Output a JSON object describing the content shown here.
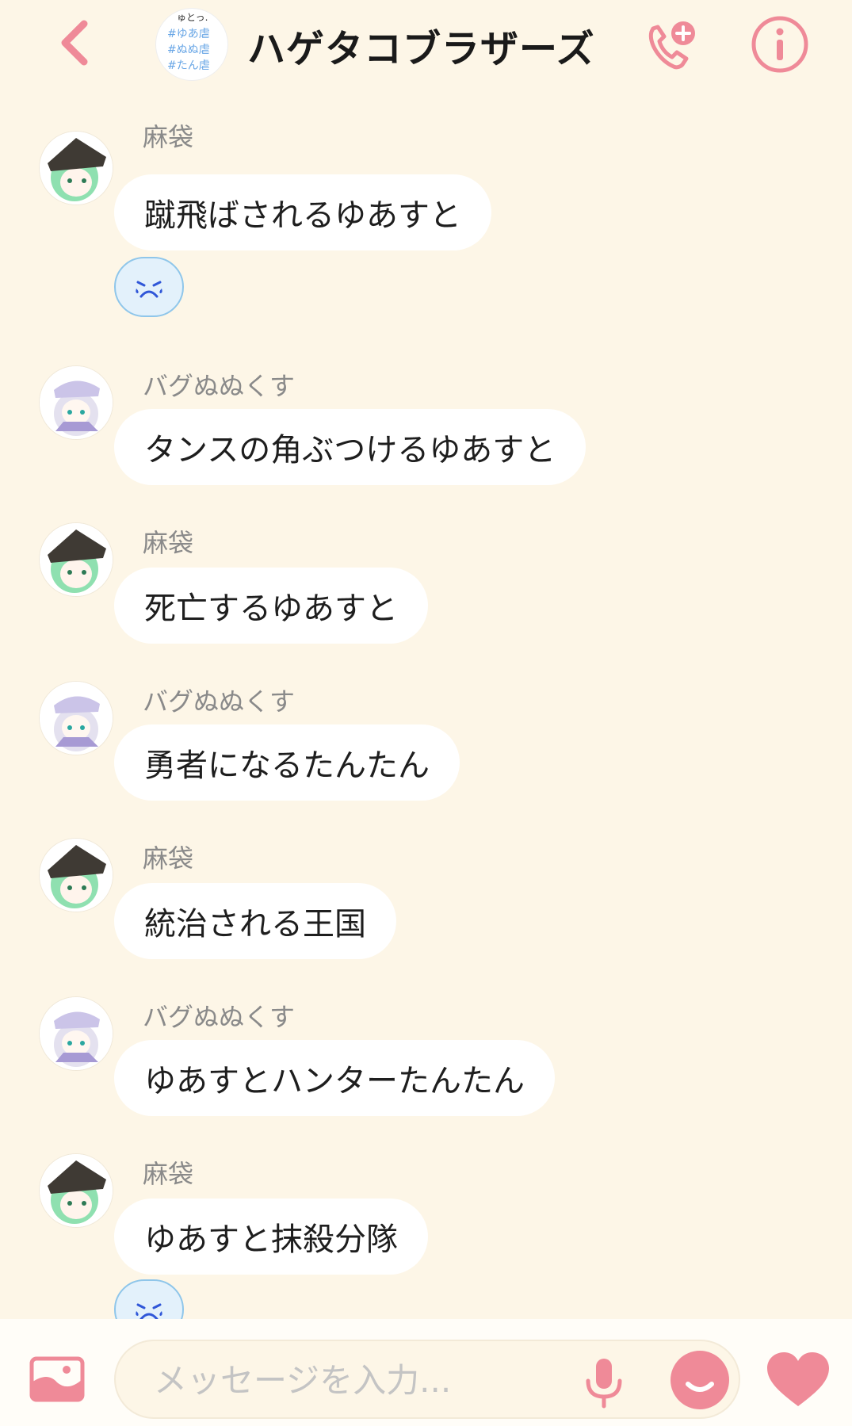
{
  "header": {
    "title": "ハゲタコブラザーズ",
    "group_avatar_tags": [
      "#ゆあ虐",
      "#ぬぬ虐",
      "#たん虐"
    ],
    "group_avatar_top_text": "ゅとっ."
  },
  "messages": [
    {
      "sender": "麻袋",
      "text": "蹴飛ばされるゆあすと",
      "avatar": "green-hair-witch-hat",
      "reaction": "crying-face"
    },
    {
      "sender": "バグぬぬくす",
      "text": "タンスの角ぶつけるゆあすと",
      "avatar": "white-hair-cap"
    },
    {
      "sender": "麻袋",
      "text": "死亡するゆあすと",
      "avatar": "green-hair-witch-hat"
    },
    {
      "sender": "バグぬぬくす",
      "text": "勇者になるたんたん",
      "avatar": "white-hair-cap"
    },
    {
      "sender": "麻袋",
      "text": "統治される王国",
      "avatar": "green-hair-witch-hat"
    },
    {
      "sender": "バグぬぬくす",
      "text": "ゆあすとハンターたんたん",
      "avatar": "white-hair-cap"
    },
    {
      "sender": "麻袋",
      "text": "ゆあすと抹殺分隊",
      "avatar": "green-hair-witch-hat",
      "reaction": "crying-face"
    }
  ],
  "composer": {
    "placeholder": "メッセージを入力..."
  },
  "colors": {
    "accent": "#ef8a98",
    "background": "#fdf6e7",
    "bubble": "#ffffff",
    "reaction_bg": "#e3f1fb",
    "reaction_border": "#8fc6ea"
  }
}
